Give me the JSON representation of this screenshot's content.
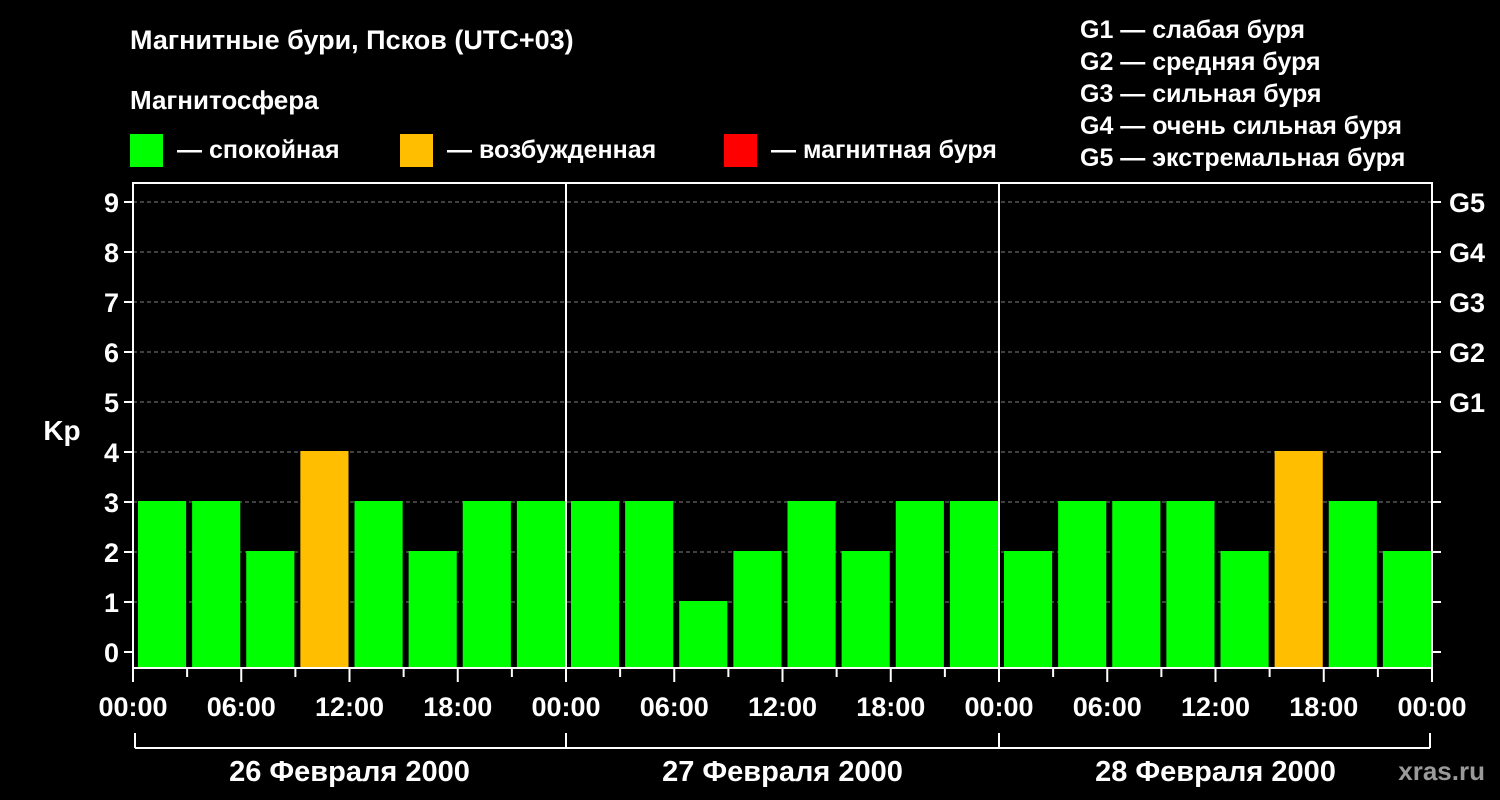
{
  "chart_data": {
    "type": "bar",
    "title": "Магнитные бури, Псков (UTC+03)",
    "subtitle": "Магнитосфера",
    "ylabel": "Kp",
    "ylim": [
      0,
      9
    ],
    "grid": true,
    "legend": [
      {
        "color": "#00ff00",
        "label": "— спокойная"
      },
      {
        "color": "#ffbf00",
        "label": "— возбужденная"
      },
      {
        "color": "#ff0000",
        "label": "— магнитная буря"
      }
    ],
    "storm_levels": [
      {
        "label": "G1 — слабая буря"
      },
      {
        "label": "G2 — средняя буря"
      },
      {
        "label": "G3 — сильная буря"
      },
      {
        "label": "G4 — очень сильная буря"
      },
      {
        "label": "G5 — экстремальная буря"
      }
    ],
    "y_ticks": [
      "0",
      "1",
      "2",
      "3",
      "4",
      "5",
      "6",
      "7",
      "8",
      "9"
    ],
    "right_ticks": [
      {
        "value": 5,
        "label": "G1"
      },
      {
        "value": 6,
        "label": "G2"
      },
      {
        "value": 7,
        "label": "G3"
      },
      {
        "value": 8,
        "label": "G4"
      },
      {
        "value": 9,
        "label": "G5"
      }
    ],
    "x_tick_labels": [
      "00:00",
      "06:00",
      "12:00",
      "18:00",
      "00:00",
      "06:00",
      "12:00",
      "18:00",
      "00:00",
      "06:00",
      "12:00",
      "18:00",
      "00:00"
    ],
    "days": [
      "26 Февраля 2000",
      "27 Февраля 2000",
      "28 Февраля 2000"
    ],
    "bar_interval_hours": 3,
    "values": [
      3,
      3,
      2,
      4,
      3,
      2,
      3,
      3,
      3,
      3,
      1,
      2,
      3,
      2,
      3,
      3,
      2,
      3,
      3,
      3,
      2,
      4,
      3,
      2
    ],
    "colors": {
      "quiet": "#00ff00",
      "unsettled": "#ffbf00",
      "storm": "#ff0000",
      "background": "#000000",
      "grid": "#808080"
    }
  },
  "watermark": "xras.ru"
}
